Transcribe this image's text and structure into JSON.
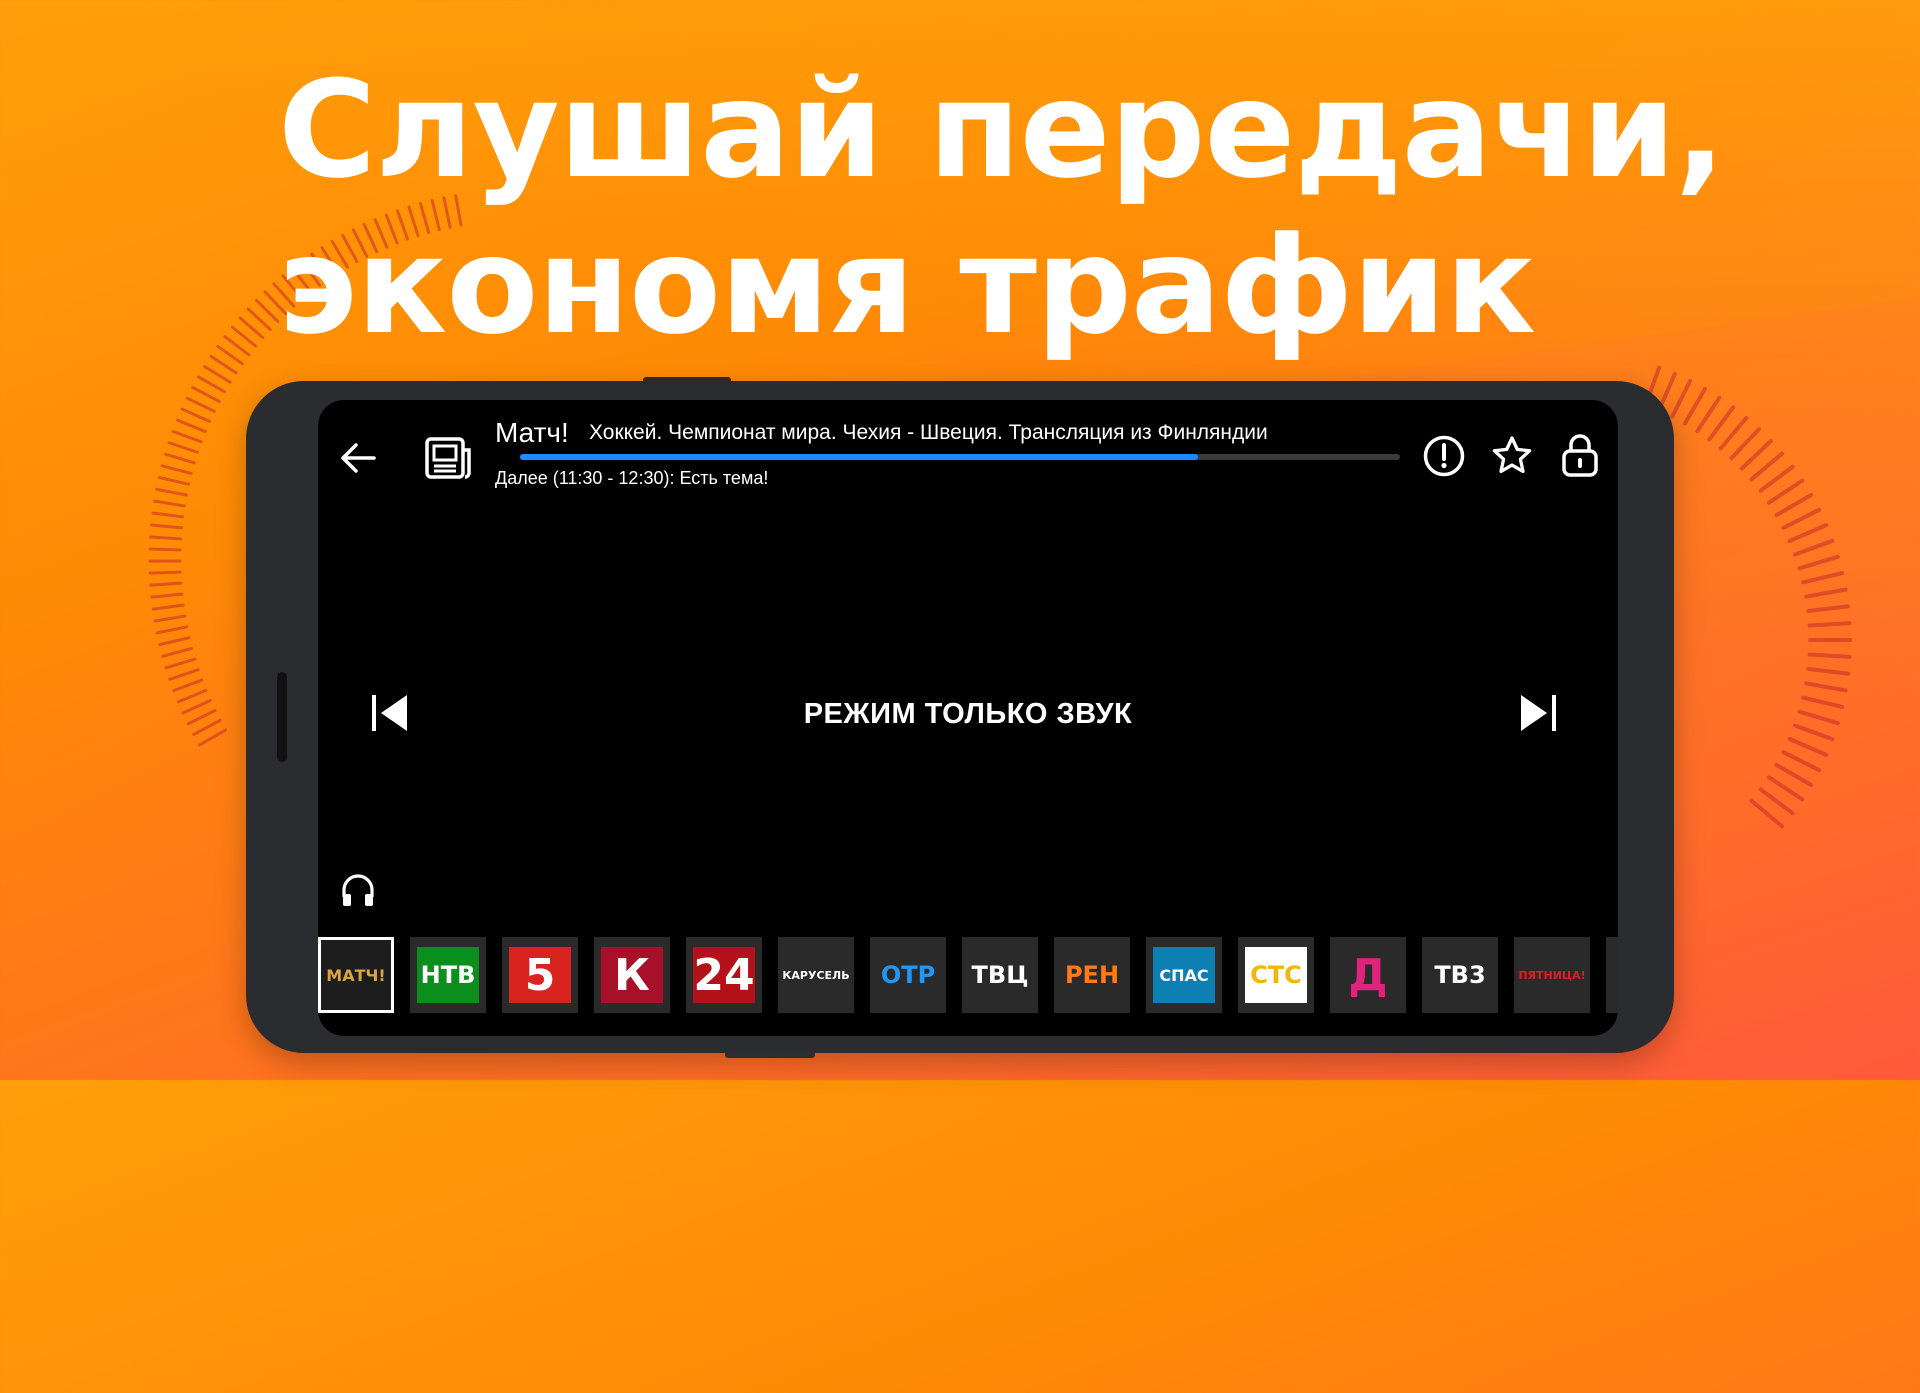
{
  "headline": {
    "line1": "Слушай передачи,",
    "line2": "экономя трафик"
  },
  "player": {
    "channel_name": "Матч!",
    "program_title": "Хоккей. Чемпионат мира. Чехия - Швеция. Трансляция из Финляндии",
    "next_program": "Далее (11:30 - 12:30): Есть тема!",
    "progress": 0.77,
    "mode_label": "РЕЖИМ ТОЛЬКО ЗВУК",
    "icons": {
      "back": "arrow-left-icon",
      "program_guide": "newspaper-icon",
      "info": "exclamation-circle-icon",
      "favorite": "star-icon",
      "lock": "lock-icon",
      "previous": "skip-previous-icon",
      "next": "skip-next-icon",
      "audio_only": "headphones-icon"
    },
    "accent_color": "#1a8cff"
  },
  "channels": [
    {
      "label": "МАТЧ!",
      "bg": "#1d1d1d",
      "color": "#d9a441",
      "selected": true
    },
    {
      "label": "НТВ",
      "bg": "#0a8f1c",
      "color": "#ffffff"
    },
    {
      "label": "5",
      "bg": "#d9231f",
      "color": "#ffffff"
    },
    {
      "label": "К",
      "bg": "#a8102a",
      "color": "#ffffff"
    },
    {
      "label": "24",
      "bg": "#b3121b",
      "color": "#ffffff"
    },
    {
      "label": "КАРУСЕЛЬ",
      "bg": "#2a2a2a",
      "color": "#ffffff"
    },
    {
      "label": "ОТР",
      "bg": "#2a2a2a",
      "color": "#2196f3"
    },
    {
      "label": "ТВЦ",
      "bg": "#2a2a2a",
      "color": "#ffffff"
    },
    {
      "label": "РЕН",
      "bg": "#2a2a2a",
      "color": "#ff7a1a"
    },
    {
      "label": "СПАС",
      "bg": "#0d7fb3",
      "color": "#ffffff"
    },
    {
      "label": "СТС",
      "bg": "#ffffff",
      "color": "#f2b705"
    },
    {
      "label": "Д",
      "bg": "#2a2a2a",
      "color": "#e0237c"
    },
    {
      "label": "ТВ3",
      "bg": "#2a2a2a",
      "color": "#ffffff"
    },
    {
      "label": "ПЯТНИЦА!",
      "bg": "#2a2a2a",
      "color": "#e31b23"
    },
    {
      "label": "",
      "bg": "#2a2a2a",
      "color": "#ffffff"
    }
  ]
}
